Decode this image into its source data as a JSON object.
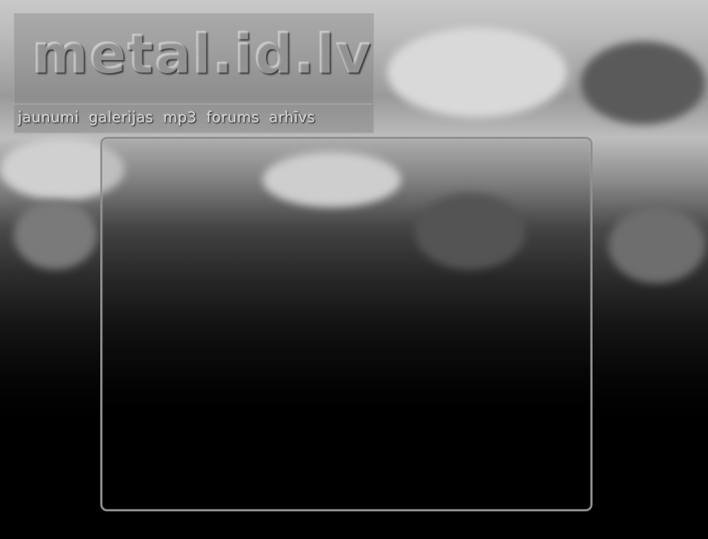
{
  "site": {
    "logo_text": "metal.id.lv"
  },
  "navigation": {
    "items": [
      {
        "label": "jaunumi"
      },
      {
        "label": "galerijas"
      },
      {
        "label": "mp3"
      },
      {
        "label": "forums"
      },
      {
        "label": "arhīvs"
      }
    ]
  },
  "colors": {
    "frame_border": "#8f8f8f",
    "nav_text": "#d8d8d8",
    "background_bottom": "#000000"
  }
}
